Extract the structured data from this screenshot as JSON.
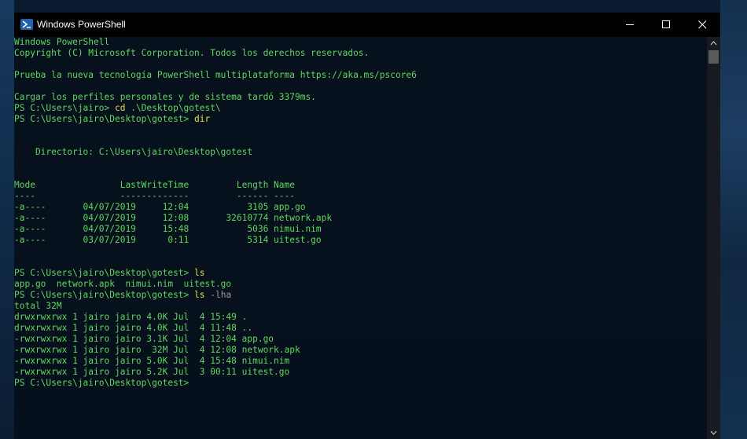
{
  "window": {
    "title": "Windows PowerShell",
    "icon": "powershell-icon",
    "controls": [
      "minimize-icon",
      "maximize-icon",
      "close-icon"
    ]
  },
  "console": {
    "lines": [
      {
        "segments": [
          {
            "text": "Windows PowerShell"
          }
        ]
      },
      {
        "segments": [
          {
            "text": "Copyright (C) Microsoft Corporation. Todos los derechos reservados."
          }
        ]
      },
      {
        "segments": [
          {
            "text": ""
          }
        ]
      },
      {
        "segments": [
          {
            "text": "Prueba la nueva tecnología PowerShell multiplataforma https://aka.ms/pscore6"
          }
        ]
      },
      {
        "segments": [
          {
            "text": ""
          }
        ]
      },
      {
        "segments": [
          {
            "text": "Cargar los perfiles personales y de sistema tardó 3379ms."
          }
        ]
      },
      {
        "segments": [
          {
            "text": "PS C:\\Users\\jairo> "
          },
          {
            "text": "cd",
            "style": "y"
          },
          {
            "text": " .\\Desktop\\gotest\\"
          }
        ]
      },
      {
        "segments": [
          {
            "text": "PS C:\\Users\\jairo\\Desktop\\gotest> "
          },
          {
            "text": "dir",
            "style": "y"
          }
        ]
      },
      {
        "segments": [
          {
            "text": ""
          }
        ]
      },
      {
        "segments": [
          {
            "text": ""
          }
        ]
      },
      {
        "segments": [
          {
            "text": "    Directorio: C:\\Users\\jairo\\Desktop\\gotest"
          }
        ]
      },
      {
        "segments": [
          {
            "text": ""
          }
        ]
      },
      {
        "segments": [
          {
            "text": ""
          }
        ]
      },
      {
        "segments": [
          {
            "text": "Mode                LastWriteTime         Length Name"
          }
        ]
      },
      {
        "segments": [
          {
            "text": "----                -------------         ------ ----"
          }
        ]
      },
      {
        "segments": [
          {
            "text": "-a----       04/07/2019     12:04           3105 app.go"
          }
        ]
      },
      {
        "segments": [
          {
            "text": "-a----       04/07/2019     12:08       32610774 network.apk"
          }
        ]
      },
      {
        "segments": [
          {
            "text": "-a----       04/07/2019     15:48           5036 nimui.nim"
          }
        ]
      },
      {
        "segments": [
          {
            "text": "-a----       03/07/2019      0:11           5314 uitest.go"
          }
        ]
      },
      {
        "segments": [
          {
            "text": ""
          }
        ]
      },
      {
        "segments": [
          {
            "text": ""
          }
        ]
      },
      {
        "segments": [
          {
            "text": "PS C:\\Users\\jairo\\Desktop\\gotest> "
          },
          {
            "text": "ls",
            "style": "y"
          }
        ]
      },
      {
        "segments": [
          {
            "text": "app.go  network.apk  nimui.nim  uitest.go"
          }
        ]
      },
      {
        "segments": [
          {
            "text": "PS C:\\Users\\jairo\\Desktop\\gotest> "
          },
          {
            "text": "ls",
            "style": "y"
          },
          {
            "text": " -lha",
            "style": "g"
          }
        ]
      },
      {
        "segments": [
          {
            "text": "total 32M"
          }
        ]
      },
      {
        "segments": [
          {
            "text": "drwxrwxrwx 1 jairo jairo 4.0K Jul  4 15:49 ."
          }
        ]
      },
      {
        "segments": [
          {
            "text": "drwxrwxrwx 1 jairo jairo 4.0K Jul  4 11:48 .."
          }
        ]
      },
      {
        "segments": [
          {
            "text": "-rwxrwxrwx 1 jairo jairo 3.1K Jul  4 12:04 app.go"
          }
        ]
      },
      {
        "segments": [
          {
            "text": "-rwxrwxrwx 1 jairo jairo  32M Jul  4 12:08 network.apk"
          }
        ]
      },
      {
        "segments": [
          {
            "text": "-rwxrwxrwx 1 jairo jairo 5.0K Jul  4 15:48 nimui.nim"
          }
        ]
      },
      {
        "segments": [
          {
            "text": "-rwxrwxrwx 1 jairo jairo 5.2K Jul  3 00:11 uitest.go"
          }
        ]
      },
      {
        "segments": [
          {
            "text": "PS C:\\Users\\jairo\\Desktop\\gotest> "
          }
        ]
      }
    ]
  },
  "colors": {
    "text": "#5dd85d",
    "command": "#e8e04a",
    "argument": "#9a9a9a",
    "titlebar": "#000000"
  }
}
